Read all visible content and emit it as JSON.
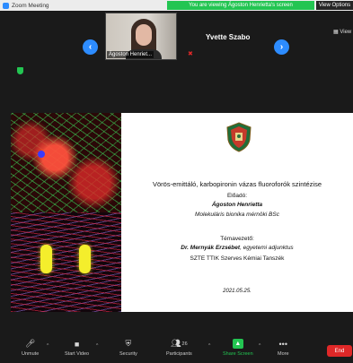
{
  "window": {
    "title": "Zoom Meeting"
  },
  "banner": {
    "text": "You are viewing Ágoston Henrietta's screen",
    "view_options": "View Options"
  },
  "gallery": {
    "thumb_name": "Ágoston Henriet...",
    "second_participant": "Yvette Szabo",
    "view_label": "View"
  },
  "slide": {
    "title": "Vörös-emittáló, karbopironin vázas fluoroforók szintézise",
    "presenter_label": "Előadó:",
    "presenter": "Ágoston Henrietta",
    "presenter_role": "Molekuláris bionika mérnöki BSc",
    "supervisor_label": "Témavezető:",
    "supervisor_name": "Dr. Mernyák Erzsébet",
    "supervisor_title": ", egyetemi adjunktus",
    "department": "SZTE TTIK Szerves Kémiai Tanszék",
    "date": "2021.05.25."
  },
  "toolbar": {
    "unmute": "Unmute",
    "start_video": "Start Video",
    "security": "Security",
    "participants": "Participants",
    "participants_count": "26",
    "share_screen": "Share Screen",
    "more": "More",
    "end": "End"
  },
  "colors": {
    "accent": "#2d8cff",
    "green": "#23c552",
    "red": "#e02828"
  }
}
